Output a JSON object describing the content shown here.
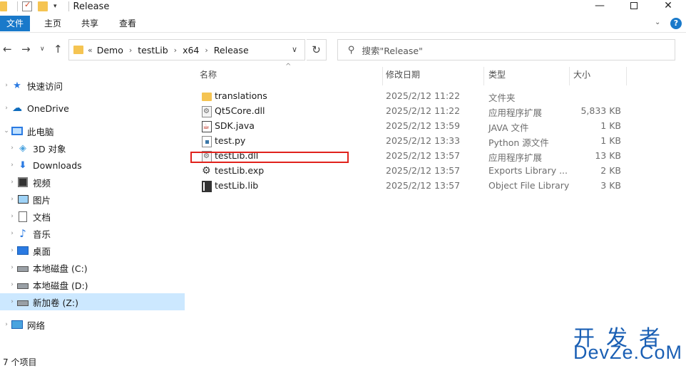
{
  "window": {
    "title": "Release"
  },
  "ribbon": {
    "tabs": [
      "文件",
      "主页",
      "共享",
      "查看"
    ]
  },
  "address_bar": {
    "breadcrumbs": [
      "Demo",
      "testLib",
      "x64",
      "Release"
    ],
    "prefix": "«"
  },
  "search": {
    "placeholder": "搜索\"Release\""
  },
  "sidebar": {
    "items": [
      {
        "label": "快速访问",
        "icon": "star-icon"
      },
      {
        "label": "OneDrive",
        "icon": "cloud-icon"
      },
      {
        "label": "此电脑",
        "icon": "computer-icon"
      },
      {
        "label": "3D 对象",
        "icon": "cube-icon"
      },
      {
        "label": "Downloads",
        "icon": "download-icon"
      },
      {
        "label": "视频",
        "icon": "video-icon"
      },
      {
        "label": "图片",
        "icon": "picture-icon"
      },
      {
        "label": "文档",
        "icon": "document-icon"
      },
      {
        "label": "音乐",
        "icon": "music-icon"
      },
      {
        "label": "桌面",
        "icon": "desktop-icon"
      },
      {
        "label": "本地磁盘 (C:)",
        "icon": "drive-icon"
      },
      {
        "label": "本地磁盘 (D:)",
        "icon": "drive-icon"
      },
      {
        "label": "新加卷 (Z:)",
        "icon": "drive-icon"
      },
      {
        "label": "网络",
        "icon": "network-icon"
      }
    ],
    "selected": "新加卷 (Z:)"
  },
  "file_list": {
    "columns": [
      "名称",
      "修改日期",
      "类型",
      "大小"
    ],
    "rows": [
      {
        "name": "translations",
        "date": "2025/2/12 11:22",
        "type": "文件夹",
        "size": "",
        "icon": "folder-icon"
      },
      {
        "name": "Qt5Core.dll",
        "date": "2025/2/12 11:22",
        "type": "应用程序扩展",
        "size": "5,833 KB",
        "icon": "dll-file-icon"
      },
      {
        "name": "SDK.java",
        "date": "2025/2/12 13:59",
        "type": "JAVA 文件",
        "size": "1 KB",
        "icon": "java-file-icon"
      },
      {
        "name": "test.py",
        "date": "2025/2/12 13:33",
        "type": "Python 源文件",
        "size": "1 KB",
        "icon": "python-file-icon"
      },
      {
        "name": "testLib.dll",
        "date": "2025/2/12 13:57",
        "type": "应用程序扩展",
        "size": "13 KB",
        "icon": "dll-file-icon"
      },
      {
        "name": "testLib.exp",
        "date": "2025/2/12 13:57",
        "type": "Exports Library ...",
        "size": "2 KB",
        "icon": "exp-file-icon"
      },
      {
        "name": "testLib.lib",
        "date": "2025/2/12 13:57",
        "type": "Object File Library",
        "size": "3 KB",
        "icon": "lib-file-icon"
      }
    ],
    "highlighted": "testLib.dll",
    "highlight_color": "#e0221c"
  },
  "status": {
    "item_count": "7 个项目"
  },
  "watermark": {
    "line1": "开发者",
    "line2": "DevZe.CoM"
  },
  "colors": {
    "accent": "#1979ca",
    "selection": "#cce8ff",
    "folder": "#f5c452"
  }
}
